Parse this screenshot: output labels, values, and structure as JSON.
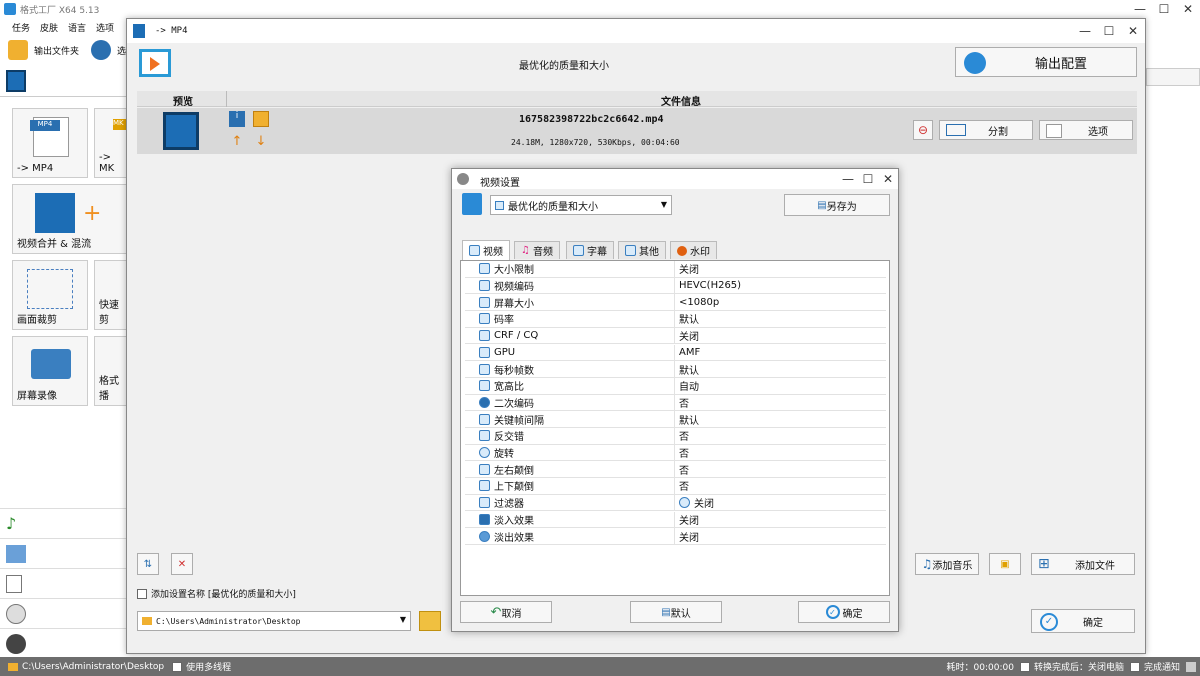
{
  "app": {
    "title": "格式工厂 X64 5.13",
    "menu": [
      "任务",
      "皮肤",
      "语言",
      "选项"
    ],
    "toolbar": {
      "output_folder": "输出文件夹",
      "options": "选项"
    },
    "tiles": [
      {
        "label": "-> MP4",
        "badge": "MP4"
      },
      {
        "label": "-> MK",
        "badge": "MK"
      },
      {
        "label": "视频合并 & 混流"
      },
      {
        "label": "画面裁剪"
      },
      {
        "label": "快速剪"
      },
      {
        "label": "屏幕录像"
      },
      {
        "label": "格式播"
      }
    ]
  },
  "mp4_dialog": {
    "title": "-> MP4",
    "preset_title": "最优化的质量和大小",
    "output_config": "输出配置",
    "columns": {
      "preview": "预览",
      "file_info": "文件信息"
    },
    "file": {
      "name": "167582398722bc2c6642.mp4",
      "details": "24.18M, 1280x720, 530Kbps, 00:04:60"
    },
    "buttons": {
      "split": "分割",
      "options": "选项",
      "add_music": "添加音乐",
      "add_file": "添加文件",
      "ok": "确定"
    },
    "add_setting_name": "添加设置名称 [最优化的质量和大小]",
    "output_path": "C:\\Users\\Administrator\\Desktop"
  },
  "video_settings": {
    "title": "视频设置",
    "preset": "最优化的质量和大小",
    "save_as": "另存为",
    "tabs": [
      "视频",
      "音频",
      "字幕",
      "其他",
      "水印"
    ],
    "rows": [
      {
        "key": "大小限制",
        "value": "关闭"
      },
      {
        "key": "视频编码",
        "value": "HEVC(H265)"
      },
      {
        "key": "屏幕大小",
        "value": "<1080p"
      },
      {
        "key": "码率",
        "value": "默认"
      },
      {
        "key": "CRF / CQ",
        "value": "关闭"
      },
      {
        "key": "GPU",
        "value": "AMF"
      },
      {
        "key": "每秒帧数",
        "value": "默认"
      },
      {
        "key": "宽高比",
        "value": "自动"
      },
      {
        "key": "二次编码",
        "value": "否"
      },
      {
        "key": "关键帧间隔",
        "value": "默认"
      },
      {
        "key": "反交错",
        "value": "否"
      },
      {
        "key": "旋转",
        "value": "否"
      },
      {
        "key": "左右颠倒",
        "value": "否"
      },
      {
        "key": "上下颠倒",
        "value": "否"
      },
      {
        "key": "过滤器",
        "value": "关闭"
      },
      {
        "key": "淡入效果",
        "value": "关闭"
      },
      {
        "key": "淡出效果",
        "value": "关闭"
      }
    ],
    "buttons": {
      "cancel": "取消",
      "default": "默认",
      "ok": "确定"
    }
  },
  "statusbar": {
    "path": "C:\\Users\\Administrator\\Desktop",
    "multithread": "使用多线程",
    "elapsed": "耗时：00:00:00",
    "after_convert": "转换完成后：关闭电脑",
    "notify": "完成通知"
  },
  "colors": {
    "accent": "#2a8ad6",
    "statusbar": "#6d6d6d",
    "filerow": "#d9d9d9"
  }
}
